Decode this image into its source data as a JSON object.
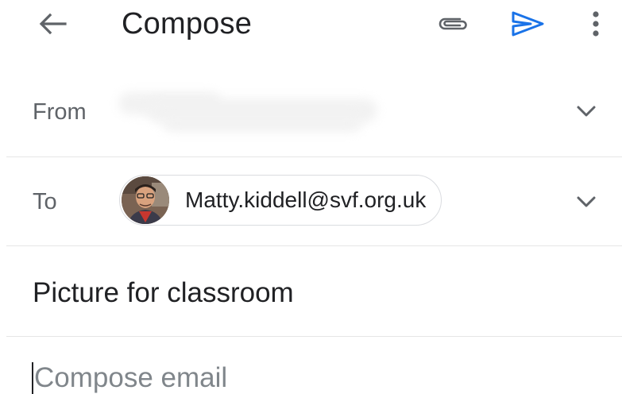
{
  "appbar": {
    "title": "Compose",
    "icons": {
      "back": "arrow-back-icon",
      "attach": "paperclip-icon",
      "send": "send-icon",
      "more": "more-vert-icon"
    }
  },
  "colors": {
    "accent": "#1a73e8",
    "label": "#5f6368",
    "text": "#202124",
    "placeholder": "#80868b",
    "divider": "#e6e6e6"
  },
  "from": {
    "label": "From"
  },
  "to": {
    "label": "To",
    "recipient": "Matty.kiddell@svf.org.uk"
  },
  "subject": {
    "value": "Picture for classroom"
  },
  "body": {
    "placeholder": "Compose email"
  }
}
